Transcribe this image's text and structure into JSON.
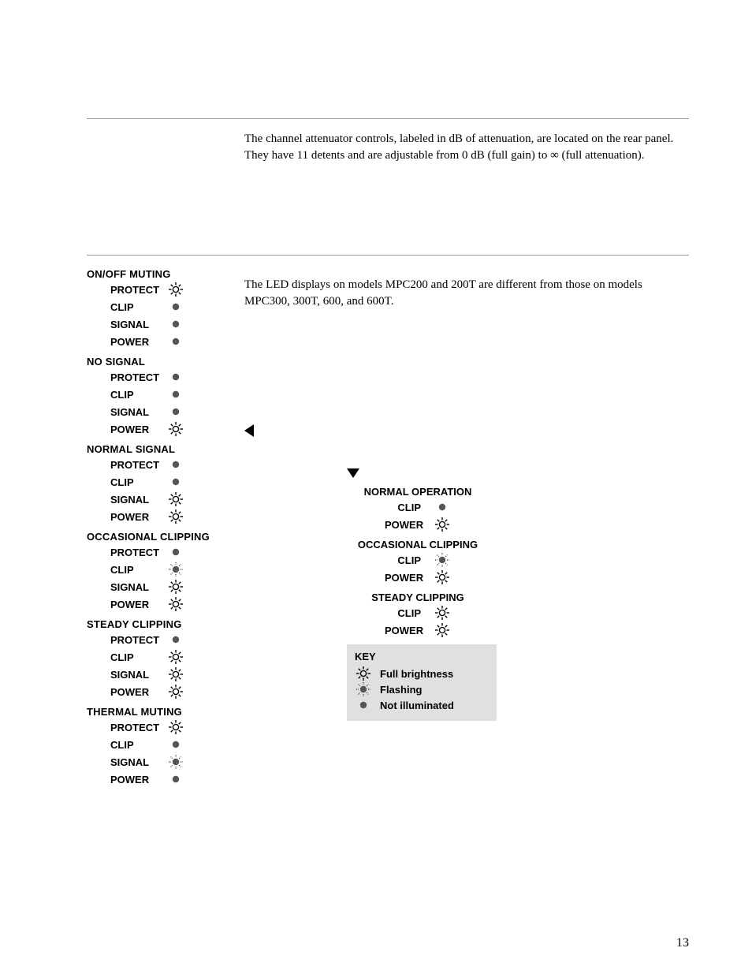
{
  "intro": "The channel attenuator controls, labeled in dB of attenuation, are located on the rear panel. They have 11 detents and are adjustable from 0 dB (full gain) to ∞ (full attenuation).",
  "right_intro": "The LED displays on models MPC200 and 200T are different from those on models MPC300, 300T, 600, and 600T.",
  "labels": {
    "protect": "PROTECT",
    "clip": "CLIP",
    "signal": "SIGNAL",
    "power": "POWER"
  },
  "left_blocks": [
    {
      "title": "ON/OFF MUTING",
      "rows": [
        [
          "PROTECT",
          "bright"
        ],
        [
          "CLIP",
          "off"
        ],
        [
          "SIGNAL",
          "off"
        ],
        [
          "POWER",
          "off"
        ]
      ]
    },
    {
      "title": "NO SIGNAL",
      "rows": [
        [
          "PROTECT",
          "off"
        ],
        [
          "CLIP",
          "off"
        ],
        [
          "SIGNAL",
          "off"
        ],
        [
          "POWER",
          "bright"
        ]
      ]
    },
    {
      "title": "NORMAL SIGNAL",
      "rows": [
        [
          "PROTECT",
          "off"
        ],
        [
          "CLIP",
          "off"
        ],
        [
          "SIGNAL",
          "bright"
        ],
        [
          "POWER",
          "bright"
        ]
      ]
    },
    {
      "title": "OCCASIONAL CLIPPING",
      "rows": [
        [
          "PROTECT",
          "off"
        ],
        [
          "CLIP",
          "flash"
        ],
        [
          "SIGNAL",
          "bright"
        ],
        [
          "POWER",
          "bright"
        ]
      ]
    },
    {
      "title": "STEADY CLIPPING",
      "rows": [
        [
          "PROTECT",
          "off"
        ],
        [
          "CLIP",
          "bright"
        ],
        [
          "SIGNAL",
          "bright"
        ],
        [
          "POWER",
          "bright"
        ]
      ]
    },
    {
      "title": "THERMAL MUTING",
      "rows": [
        [
          "PROTECT",
          "bright"
        ],
        [
          "CLIP",
          "off"
        ],
        [
          "SIGNAL",
          "flash"
        ],
        [
          "POWER",
          "off"
        ]
      ]
    }
  ],
  "right_blocks": [
    {
      "title": "NORMAL OPERATION",
      "rows": [
        [
          "CLIP",
          "off"
        ],
        [
          "POWER",
          "bright"
        ]
      ]
    },
    {
      "title": "OCCASIONAL CLIPPING",
      "rows": [
        [
          "CLIP",
          "flash"
        ],
        [
          "POWER",
          "bright"
        ]
      ]
    },
    {
      "title": "STEADY CLIPPING",
      "rows": [
        [
          "CLIP",
          "bright"
        ],
        [
          "POWER",
          "bright"
        ]
      ]
    }
  ],
  "key": {
    "title": "KEY",
    "items": [
      [
        "bright",
        "Full brightness"
      ],
      [
        "flash",
        "Flashing"
      ],
      [
        "off",
        "Not illuminated"
      ]
    ]
  },
  "page_number": "13"
}
